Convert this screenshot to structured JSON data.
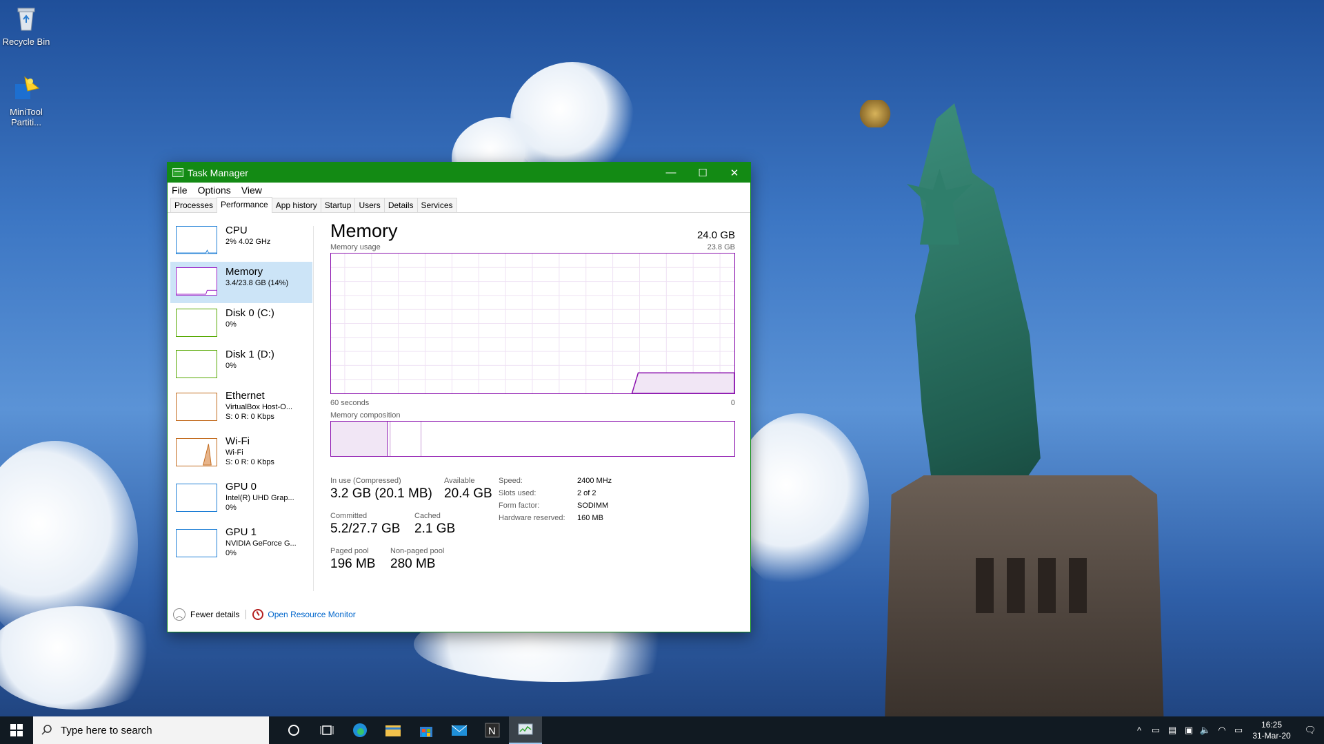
{
  "desktop": {
    "icons": [
      {
        "label": "Recycle Bin",
        "icon": "recycle-bin-icon"
      },
      {
        "label": "MiniTool Partiti...",
        "icon": "minitool-icon"
      }
    ]
  },
  "window": {
    "title": "Task Manager",
    "controls": {
      "minimize": "—",
      "maximize": "☐",
      "close": "✕"
    },
    "menu": [
      "File",
      "Options",
      "View"
    ],
    "tabs": [
      "Processes",
      "Performance",
      "App history",
      "Startup",
      "Users",
      "Details",
      "Services"
    ],
    "active_tab": "Performance",
    "accent_color": "#138a14"
  },
  "sidebar": {
    "items": [
      {
        "name": "CPU",
        "sub1": "2% 4.02 GHz",
        "sub2": "",
        "color": "#1f7fd6"
      },
      {
        "name": "Memory",
        "sub1": "3.4/23.8 GB (14%)",
        "sub2": "",
        "color": "#9b1ec6",
        "selected": true
      },
      {
        "name": "Disk 0 (C:)",
        "sub1": "0%",
        "sub2": "",
        "color": "#55a800"
      },
      {
        "name": "Disk 1 (D:)",
        "sub1": "0%",
        "sub2": "",
        "color": "#55a800"
      },
      {
        "name": "Ethernet",
        "sub1": "VirtualBox Host-O...",
        "sub2": "S: 0 R: 0 Kbps",
        "color": "#c26a1c"
      },
      {
        "name": "Wi-Fi",
        "sub1": "Wi-Fi",
        "sub2": "S: 0 R: 0 Kbps",
        "color": "#c26a1c"
      },
      {
        "name": "GPU 0",
        "sub1": "Intel(R) UHD Grap...",
        "sub2": "0%",
        "color": "#1f7fd6"
      },
      {
        "name": "GPU 1",
        "sub1": "NVIDIA GeForce G...",
        "sub2": "0%",
        "color": "#1f7fd6"
      }
    ]
  },
  "memory": {
    "heading": "Memory",
    "total": "24.0 GB",
    "usage_label": "Memory usage",
    "usage_max": "23.8 GB",
    "time_left": "60 seconds",
    "time_right": "0",
    "composition_label": "Memory composition",
    "in_use_label": "In use (Compressed)",
    "in_use_value": "3.2 GB (20.1 MB)",
    "available_label": "Available",
    "available_value": "20.4 GB",
    "committed_label": "Committed",
    "committed_value": "5.2/27.7 GB",
    "cached_label": "Cached",
    "cached_value": "2.1 GB",
    "paged_label": "Paged pool",
    "paged_value": "196 MB",
    "nonpaged_label": "Non-paged pool",
    "nonpaged_value": "280 MB",
    "specs": [
      {
        "key": "Speed:",
        "value": "2400 MHz"
      },
      {
        "key": "Slots used:",
        "value": "2 of 2"
      },
      {
        "key": "Form factor:",
        "value": "SODIMM"
      },
      {
        "key": "Hardware reserved:",
        "value": "160 MB"
      }
    ],
    "line_color": "#8b12ae"
  },
  "footer": {
    "fewer_details": "Fewer details",
    "resource_monitor": "Open Resource Monitor"
  },
  "taskbar": {
    "search_placeholder": "Type here to search",
    "apps": [
      "cortana-icon",
      "task-view-icon",
      "edge-icon",
      "file-explorer-icon",
      "store-icon",
      "mail-icon",
      "n-app-icon",
      "task-manager-icon"
    ],
    "time": "16:25",
    "date": "31-Mar-20"
  }
}
